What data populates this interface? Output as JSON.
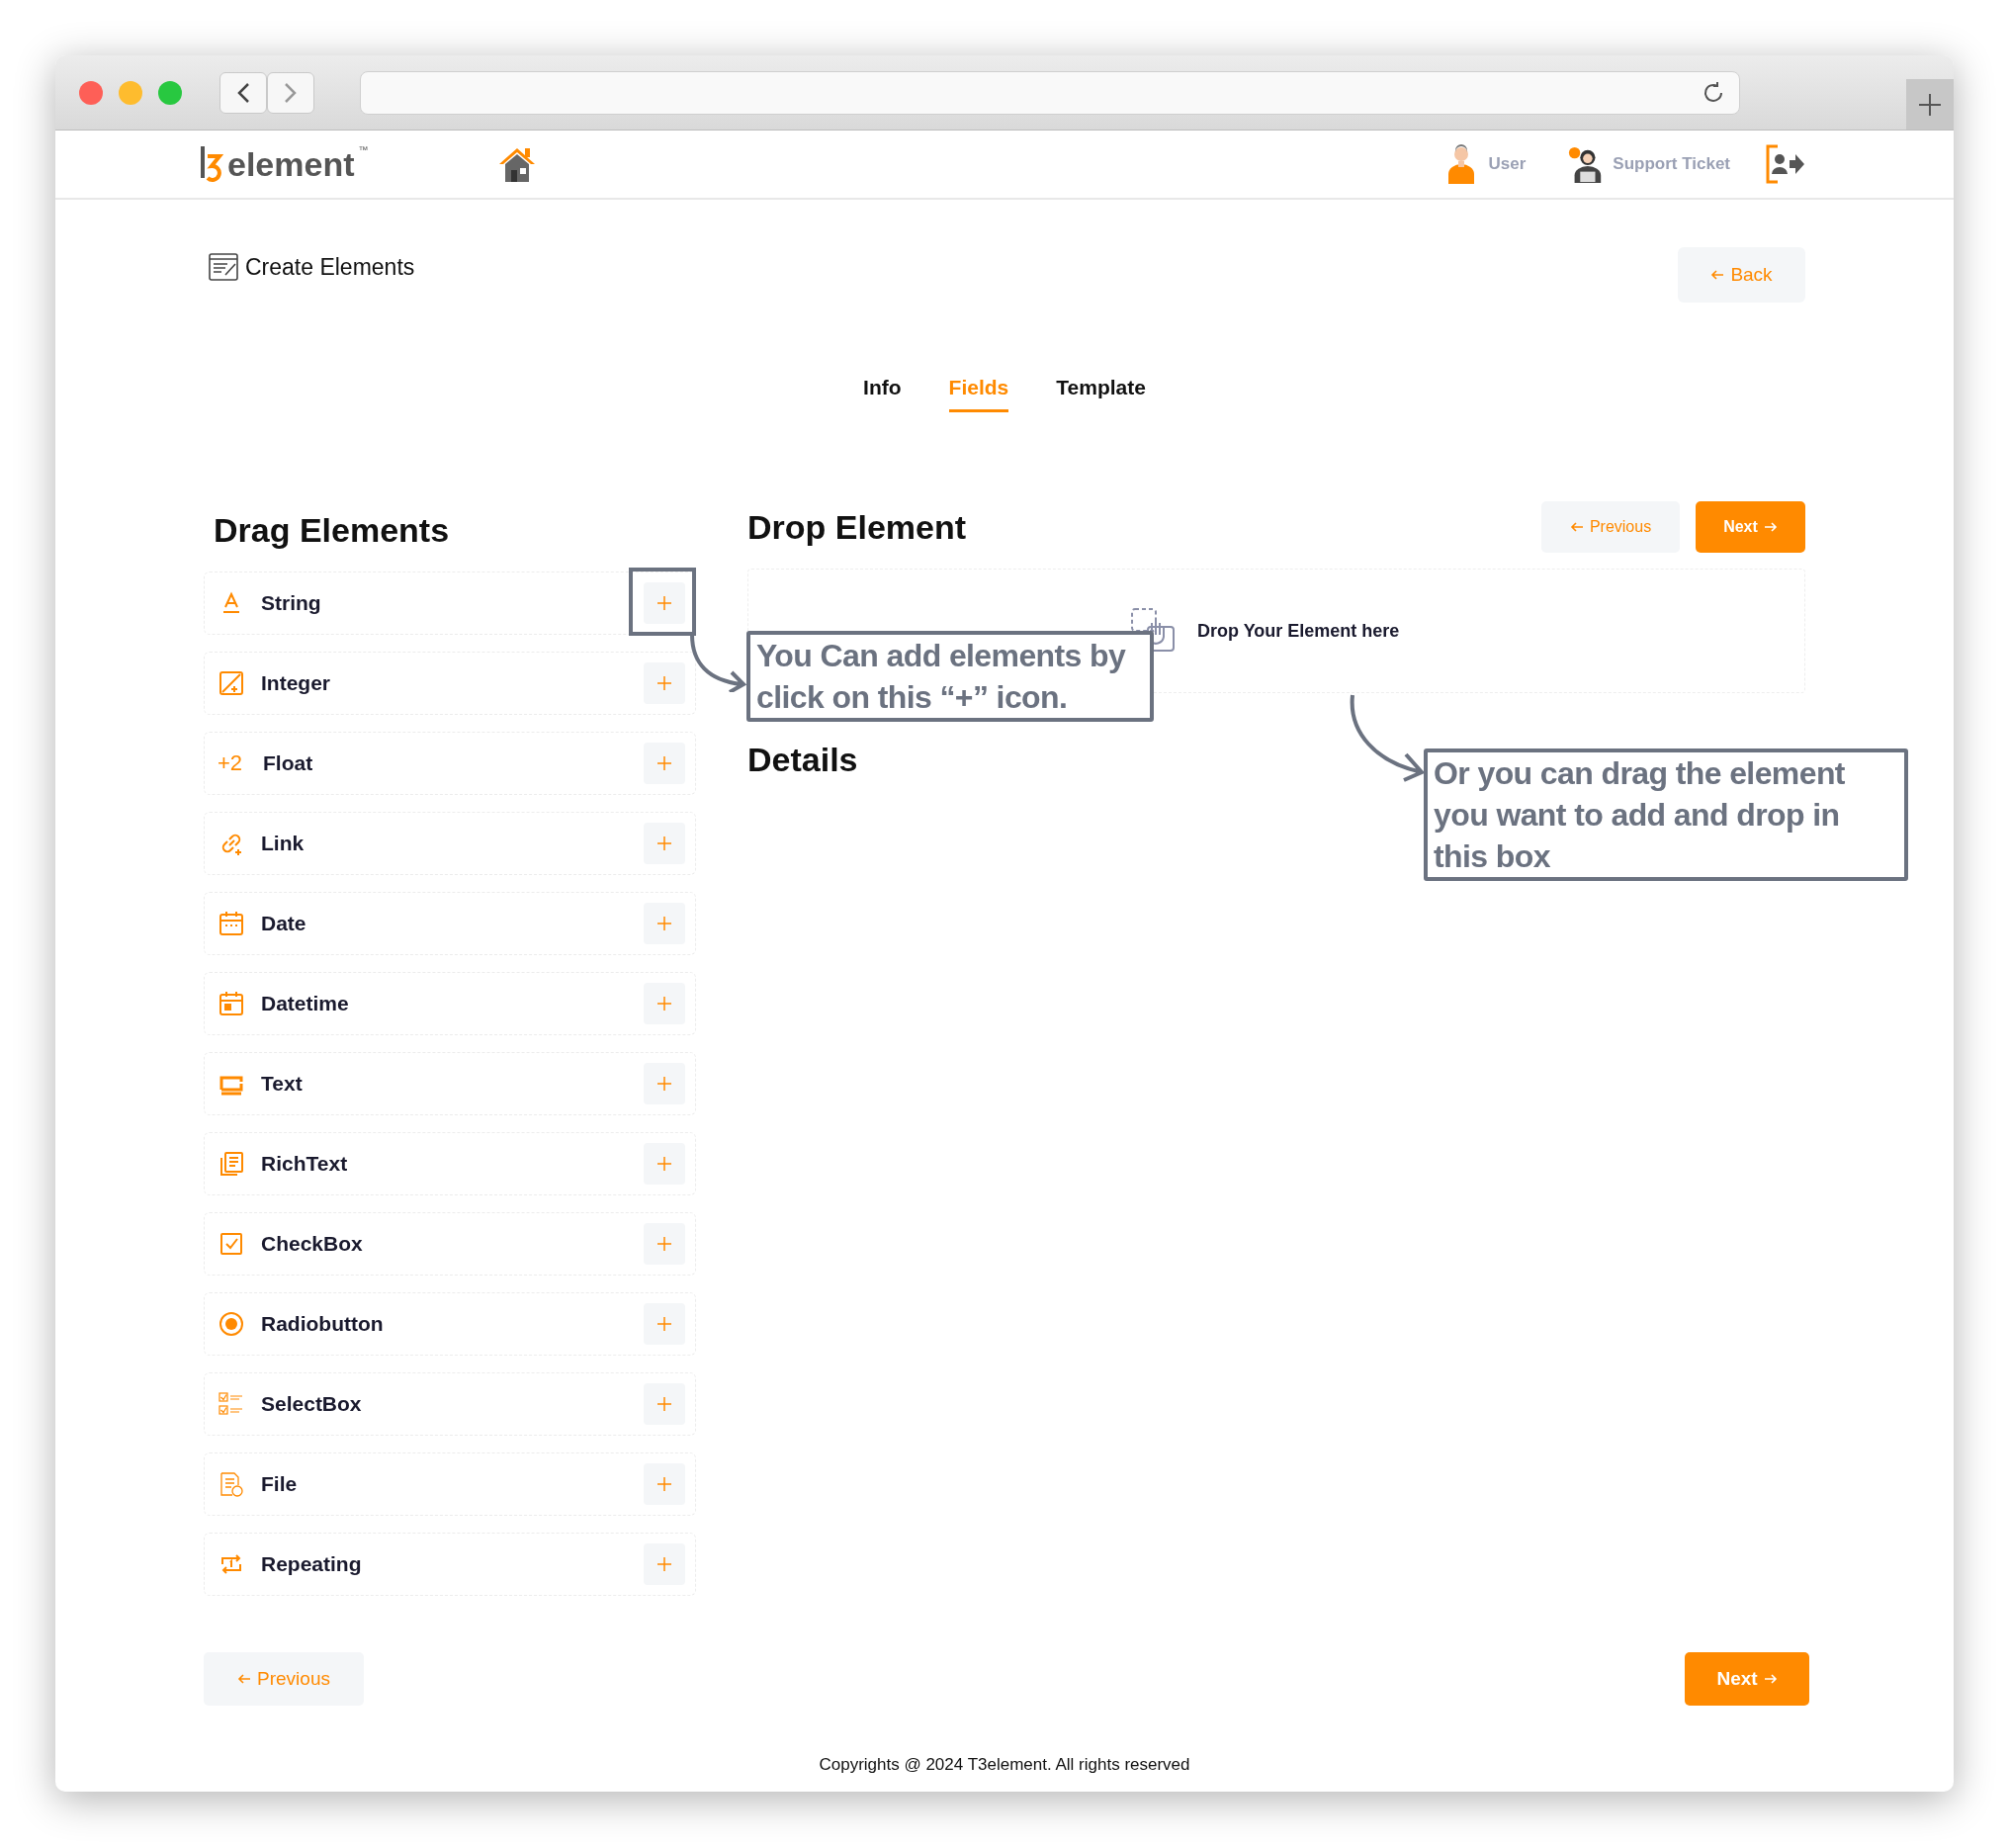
{
  "header": {
    "logo": {
      "text": "element",
      "mark": "™"
    },
    "nav": [
      {
        "label": "User",
        "kind": "user"
      },
      {
        "label": "Support Ticket",
        "kind": "support"
      }
    ]
  },
  "page": {
    "title": "Create Elements",
    "back": "Back"
  },
  "tabs": [
    {
      "label": "Info",
      "selected": false
    },
    {
      "label": "Fields",
      "selected": true
    },
    {
      "label": "Template",
      "selected": false
    }
  ],
  "drag": {
    "heading": "Drag Elements",
    "items": [
      {
        "label": "String",
        "kind": "string"
      },
      {
        "label": "Integer",
        "kind": "integer"
      },
      {
        "label": "Float",
        "kind": "float",
        "icon_text": "+2"
      },
      {
        "label": "Link",
        "kind": "link"
      },
      {
        "label": "Date",
        "kind": "date"
      },
      {
        "label": "Datetime",
        "kind": "datetime"
      },
      {
        "label": "Text",
        "kind": "text"
      },
      {
        "label": "RichText",
        "kind": "richtext"
      },
      {
        "label": "CheckBox",
        "kind": "checkbox"
      },
      {
        "label": "Radiobutton",
        "kind": "radio"
      },
      {
        "label": "SelectBox",
        "kind": "selectbox"
      },
      {
        "label": "File",
        "kind": "file"
      },
      {
        "label": "Repeating",
        "kind": "repeating"
      }
    ]
  },
  "drop": {
    "heading": "Drop Element",
    "previous": "Previous",
    "next": "Next",
    "hint": "Drop Your Element here",
    "details": "Details"
  },
  "bottom_nav": {
    "previous": "Previous",
    "next": "Next"
  },
  "footer": "Copyrights @ 2024 T3element. All rights reserved",
  "annotations": [
    {
      "kind": "click",
      "text": "You Can add elements by click on this “+” icon."
    },
    {
      "kind": "drag",
      "text": "Or you can drag the element you want to add and drop in this box"
    }
  ]
}
